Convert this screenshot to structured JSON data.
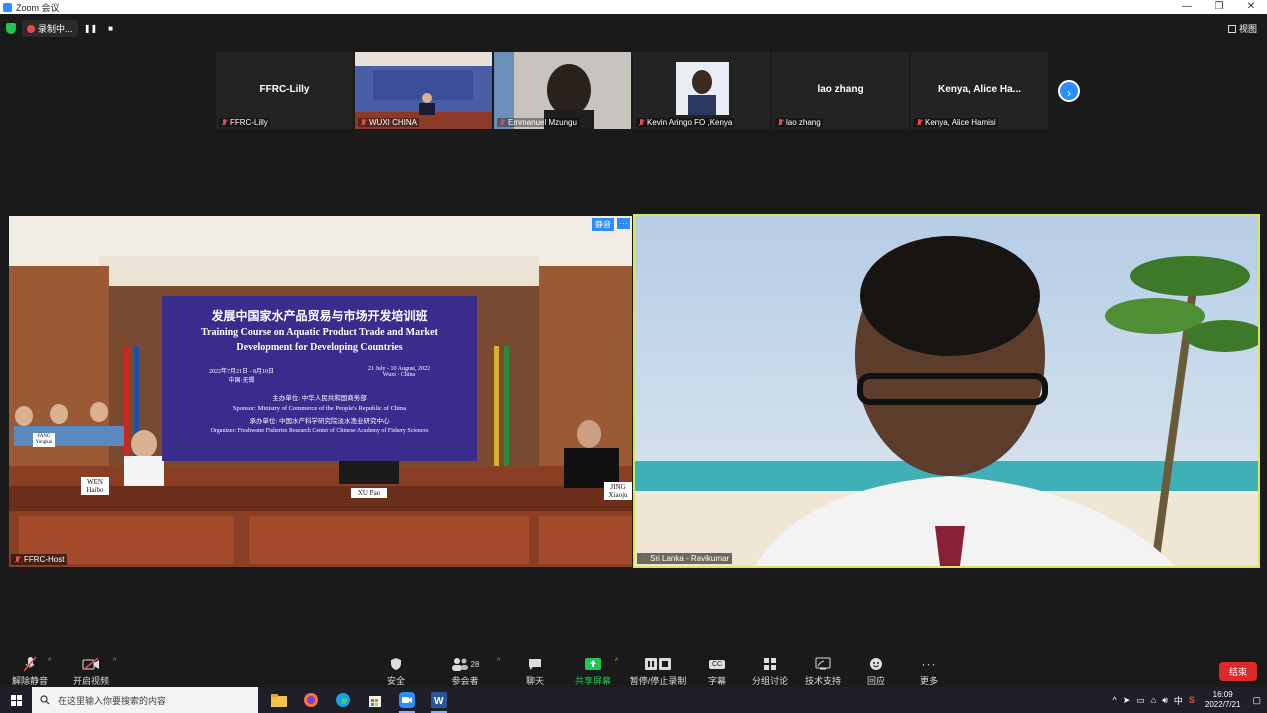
{
  "window": {
    "title": "Zoom 会议",
    "min": "—",
    "restore": "❐",
    "close": "✕"
  },
  "topbar": {
    "recording_label": "录制中...",
    "pause": "❚❚",
    "stop": "■",
    "view_label": "视图"
  },
  "thumbnails": [
    {
      "center_name": "FFRC-Lilly",
      "label": "FFRC-Lilly",
      "has_video": false
    },
    {
      "center_name": "",
      "label": "WUXI CHINA",
      "has_video": true
    },
    {
      "center_name": "",
      "label": "Emmanuel Mzungu",
      "has_video": true
    },
    {
      "center_name": "",
      "label": "Kevin Aringo FO ,Kenya",
      "has_video": true
    },
    {
      "center_name": "lao zhang",
      "label": "lao zhang",
      "has_video": false
    },
    {
      "center_name": "Kenya, Alice Ha...",
      "label": "Kenya, Alice Hamisi",
      "has_video": false
    }
  ],
  "main_left": {
    "label": "FFRC-Host",
    "mute_tag": "静音",
    "more_tag": "···",
    "banner": {
      "cn_title": "发展中国家水产品贸易与市场开发培训班",
      "en_title_1": "Training Course on Aquatic Product Trade and Market",
      "en_title_2": "Development for Developing Countries",
      "date_cn": "2022年7月21日 - 8月10日",
      "place_cn": "中国·无锡",
      "date_en": "21 July - 10 August, 2022",
      "place_en": "Wuxi · China",
      "host_cn": "主办单位: 中华人民共和国商务部",
      "sponsor_en": "Sponsor: Ministry of Commerce of the People's Republic of China",
      "organizer_cn": "承办单位: 中国水产科学研究院淡水渔业研究中心",
      "organizer_en": "Organizer: Freshwater Fisheries Research Center of Chinese Academy of Fishery Sciences"
    },
    "nameplates": {
      "wen": "WEN\nHaibo",
      "xu": "XU Pao",
      "jing": "JING\nXiaoju",
      "fang": "FANG\nYongkai"
    }
  },
  "main_right": {
    "label": "Sri Lanka - Ravikumar"
  },
  "toolbar": {
    "unmute": "解除静音",
    "start_video": "开启视频",
    "security": "安全",
    "participants": "参会者",
    "participant_count": "28",
    "chat": "聊天",
    "share": "共享屏幕",
    "record": "暂停/停止录制",
    "captions": "字幕",
    "captions_icon": "CC",
    "breakout": "分组讨论",
    "support": "技术支持",
    "reactions": "回应",
    "more": "更多",
    "end": "结束",
    "share_color": "#23c552",
    "end_color": "#e02828"
  },
  "taskbar": {
    "search_placeholder": "在这里输入你要搜索的内容",
    "ime": "中",
    "time": "16:09",
    "date": "2022/7/21"
  }
}
